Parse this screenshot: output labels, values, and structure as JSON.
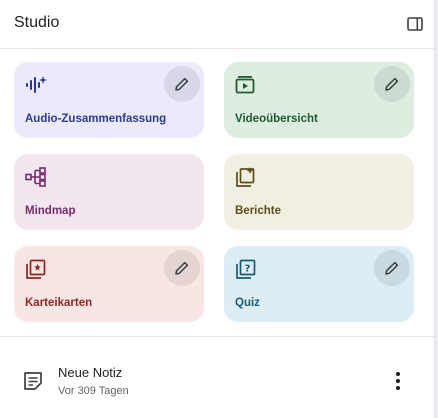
{
  "header": {
    "title": "Studio",
    "toggle_icon": "panel-toggle-icon"
  },
  "cards": [
    {
      "label": "Audio-Zusammenfassung",
      "icon": "audio-sparkle-icon",
      "bg": "#eaeafb",
      "color": "#2c3a8f",
      "editable": true
    },
    {
      "label": "Videoübersicht",
      "icon": "video-play-icon",
      "bg": "#ddeee1",
      "color": "#1e5b2e",
      "editable": true
    },
    {
      "label": "Mindmap",
      "icon": "mindmap-icon",
      "bg": "#f2e6ef",
      "color": "#7a2a6e",
      "editable": false
    },
    {
      "label": "Berichte",
      "icon": "report-sparkle-icon",
      "bg": "#f1efe2",
      "color": "#5c4e1c",
      "editable": false
    },
    {
      "label": "Karteikarten",
      "icon": "flashcards-icon",
      "bg": "#f8e6e4",
      "color": "#8a2a22",
      "editable": true
    },
    {
      "label": "Quiz",
      "icon": "quiz-icon",
      "bg": "#dcedf3",
      "color": "#1c5a72",
      "editable": true
    }
  ],
  "note": {
    "title": "Neue Notiz",
    "subtitle": "Vor 309 Tagen",
    "icon": "note-icon",
    "more_icon": "more-vert-icon"
  },
  "colors": {
    "edit_button_bg": "rgba(0,0,0,0.08)",
    "text_primary": "#1f1f1f",
    "text_secondary": "#5f6368"
  }
}
